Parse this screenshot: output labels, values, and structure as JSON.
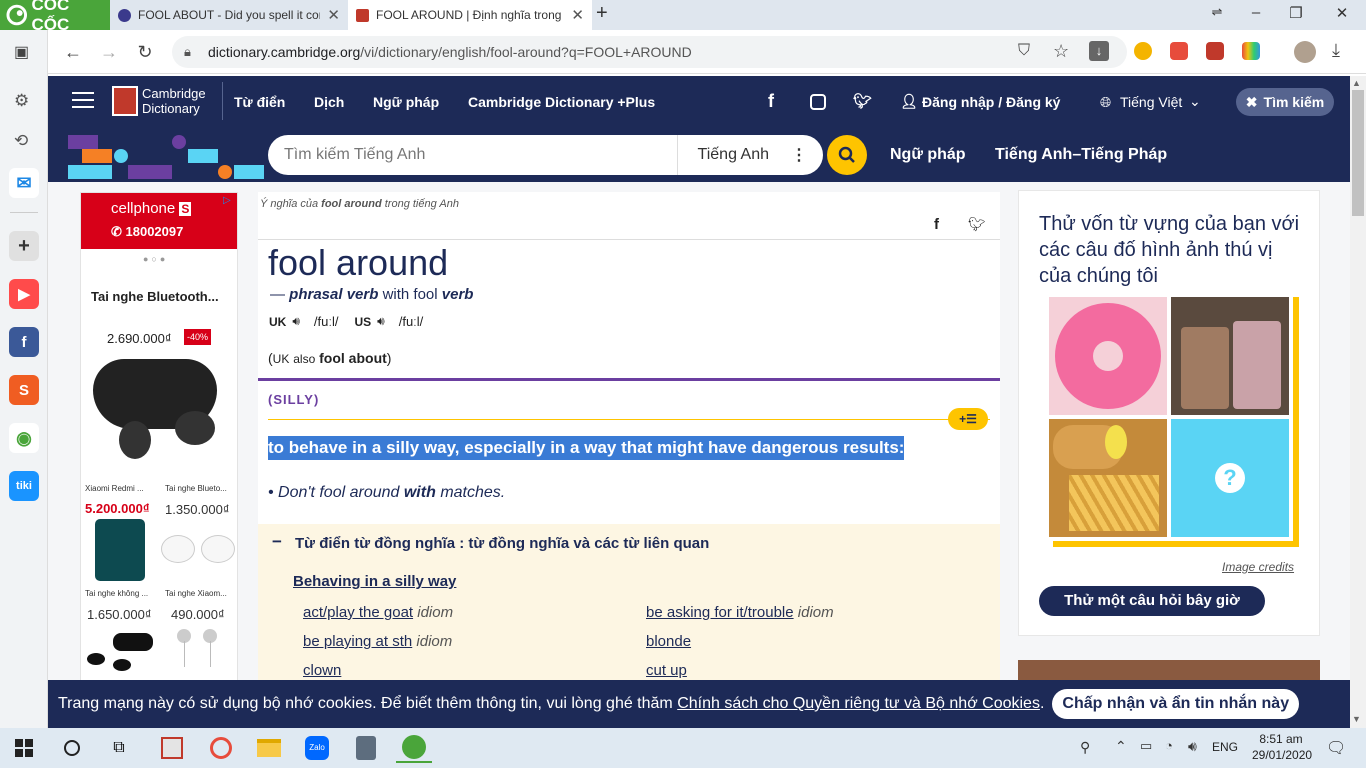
{
  "browser": {
    "brand": "CỐC CỐC",
    "tabs": [
      {
        "title": "FOOL ABOUT - Did you spell it cor",
        "color": "#3b3a8c"
      },
      {
        "title": "FOOL AROUND | Định nghĩa trong",
        "color": "#c0392b"
      }
    ],
    "url_host": "dictionary.cambridge.org",
    "url_path": "/vi/dictionary/english/fool-around?q=FOOL+AROUND"
  },
  "site": {
    "logo_line1": "Cambridge",
    "logo_line2": "Dictionary",
    "nav": [
      "Từ điển",
      "Dịch",
      "Ngữ pháp",
      "Cambridge Dictionary +Plus"
    ],
    "login": "Đăng nhập / Đăng ký",
    "language": "Tiếng Việt",
    "search_btn": "Tìm kiếm",
    "search_placeholder": "Tìm kiếm Tiếng Anh",
    "search_lang": "Tiếng Anh",
    "subnav": [
      "Ngữ pháp",
      "Tiếng Anh–Tiếng Pháp"
    ]
  },
  "ad": {
    "shop": "cellphone",
    "shop_badge": "S",
    "phone": "18002097",
    "product": "Tai nghe Bluetooth...",
    "price": "2.690.000₫",
    "discount": "-40%",
    "grid": [
      {
        "name": "Xiaomi Redmi ...",
        "price": "5.200.000₫",
        "red": true
      },
      {
        "name": "Tai nghe Blueto...",
        "price": "1.350.000₫",
        "red": false
      },
      {
        "name": "Tai nghe không ...",
        "price": "1.650.000₫",
        "red": false
      },
      {
        "name": "Tai nghe Xiaom...",
        "price": "490.000₫",
        "red": false
      }
    ]
  },
  "entry": {
    "breadcrumb_pre": "Ý nghĩa của",
    "breadcrumb_word": "fool around",
    "breadcrumb_post": "trong tiếng Anh",
    "headword": "fool around",
    "dash": "—",
    "pos": "phrasal verb",
    "with_text": "with fool",
    "pos_word": "verb",
    "uk_label": "UK",
    "uk_ipa": "/fuːl/",
    "us_label": "US",
    "us_ipa": "/fuːl/",
    "also_open": "(",
    "also_uk": "UK",
    "also_word": "also",
    "also_variant": "fool about",
    "also_close": ")",
    "guideword": "(SILLY)",
    "def_tool": "+☰",
    "definition": "to behave in a silly way, especially in a way that might have dangerous results:",
    "example_pre": "Don't fool around",
    "example_bold": "with",
    "example_post": "matches.",
    "thesaurus_header": "Từ điển từ đồng nghĩa : từ đồng nghĩa và các từ liên quan",
    "thesaurus_sub": "Behaving in a silly way",
    "related": [
      {
        "word": "act/play the goat",
        "tag": "idiom"
      },
      {
        "word": "be asking for it/trouble",
        "tag": "idiom"
      },
      {
        "word": "be playing at sth",
        "tag": "idiom"
      },
      {
        "word": "blonde",
        "tag": ""
      },
      {
        "word": "clown",
        "tag": ""
      },
      {
        "word": "cut up",
        "tag": ""
      }
    ]
  },
  "quiz": {
    "text": "Thử vốn từ vựng của bạn với các câu đố hình ảnh thú vị của chúng tôi",
    "credits": "Image credits",
    "button": "Thử một câu hỏi bây giờ",
    "question_mark": "?"
  },
  "cookie": {
    "text": "Trang mạng này có sử dụng bộ nhớ cookies. Để biết thêm thông tin, vui lòng ghé thăm",
    "link": "Chính sách cho Quyền riêng tư và Bộ nhớ Cookies",
    "dot": ".",
    "button": "Chấp nhận và ẩn tin nhắn này"
  },
  "taskbar": {
    "lang": "ENG",
    "time": "8:51 am",
    "date": "29/01/2020"
  },
  "colors": {
    "navy": "#1d2a57",
    "yellow": "#fec400",
    "highlight": "#3a7bd5",
    "purple": "#6b3fa0"
  }
}
